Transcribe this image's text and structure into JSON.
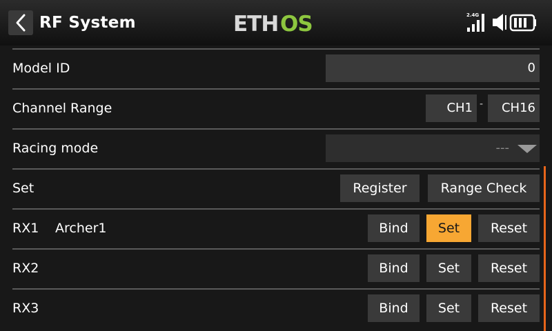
{
  "header": {
    "title": "RF System",
    "logo_text": "ETHOS",
    "rf_band": "2.4G",
    "icons": [
      "back-chevron-icon",
      "signal-bars-icon",
      "speaker-icon",
      "battery-icon"
    ],
    "accent": "#f7a733",
    "logo_green": "#8dc63f"
  },
  "settings": {
    "model_id": {
      "label": "Model ID",
      "value": "0"
    },
    "channel_range": {
      "label": "Channel Range",
      "start": "CH1",
      "separator": "-",
      "end": "CH16"
    },
    "racing_mode": {
      "label": "Racing mode",
      "value": "---"
    },
    "set": {
      "label": "Set",
      "register_label": "Register",
      "range_check_label": "Range Check"
    }
  },
  "receivers": [
    {
      "label": "RX1",
      "name": "Archer1",
      "bind_label": "Bind",
      "set_label": "Set",
      "reset_label": "Reset",
      "set_active": true
    },
    {
      "label": "RX2",
      "name": "",
      "bind_label": "Bind",
      "set_label": "Set",
      "reset_label": "Reset",
      "set_active": false
    },
    {
      "label": "RX3",
      "name": "",
      "bind_label": "Bind",
      "set_label": "Set",
      "reset_label": "Reset",
      "set_active": false
    }
  ],
  "colors": {
    "background": "#181818",
    "field": "#3a3a3a",
    "scrollbar": "#e8651b"
  }
}
